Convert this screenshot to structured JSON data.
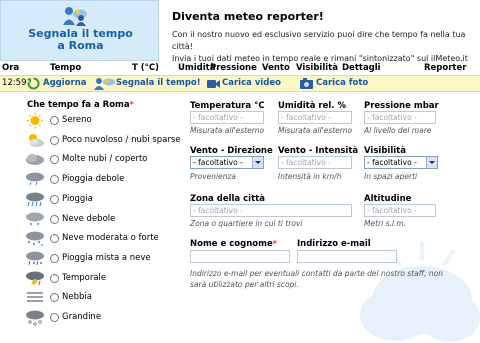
{
  "banner": {
    "icon": "reporter-people-icon",
    "line1": "Segnala il tempo",
    "line2": "a Roma"
  },
  "promo": {
    "title": "Diventa meteo reporter!",
    "line1": "Con il nostro nuovo ed esclusivo servizio puoi dire che tempo fa nella tua città!",
    "line2": "Invia i tuoi dati meteo in tempo reale e rimani \"sintonizzato\" sul ilMeteo.it"
  },
  "header": {
    "ora": "Ora",
    "tempo": "Tempo",
    "temp": "T (°C)",
    "umidita": "Umidità",
    "pressione": "Pressione",
    "vento": "Vento",
    "visibilita": "Visibilità",
    "dettagli": "Dettagli",
    "reporter": "Reporter"
  },
  "toolbar": {
    "time": "12:59",
    "refresh": "Aggiorna",
    "report": "Segnala il tempo!",
    "video": "Carica video",
    "photo": "Carica foto"
  },
  "weather": {
    "title": "Che tempo fa a Roma",
    "required_mark": "*",
    "options": [
      {
        "label": "Sereno",
        "icon": "sun-icon"
      },
      {
        "label": "Poco nuvoloso / nubi sparse",
        "icon": "sun-cloud-icon"
      },
      {
        "label": "Molte nubi / coperto",
        "icon": "cloud-icon"
      },
      {
        "label": "Pioggia debole",
        "icon": "light-rain-icon"
      },
      {
        "label": "Pioggia",
        "icon": "rain-icon"
      },
      {
        "label": "Neve debole",
        "icon": "light-snow-icon"
      },
      {
        "label": "Neve moderata o forte",
        "icon": "snow-icon"
      },
      {
        "label": "Pioggia mista a neve",
        "icon": "sleet-icon"
      },
      {
        "label": "Temporale",
        "icon": "thunderstorm-icon"
      },
      {
        "label": "Nebbia",
        "icon": "fog-icon"
      },
      {
        "label": "Grandine",
        "icon": "hail-icon"
      }
    ]
  },
  "form": {
    "placeholder": "- facoltativo -",
    "temperature": {
      "label": "Temperatura °C",
      "note": "Misurata all'esterno"
    },
    "humidity": {
      "label": "Umidità rel. %",
      "note": "Misurata all'esterno"
    },
    "pressure": {
      "label": "Pressione mbar",
      "note": "Al livello del mare"
    },
    "wind_dir": {
      "label": "Vento - Direzione",
      "value": "- facoltativo -",
      "note": "Provenienza"
    },
    "wind_int": {
      "label": "Vento - Intensità",
      "note": "Intensità in km/h"
    },
    "visibility": {
      "label": "Visibilità",
      "value": "- facoltativo -",
      "note": "In spazi aperti"
    },
    "zone": {
      "label": "Zona della città",
      "note": "Zona o quartiere in cui ti trovi"
    },
    "altitude": {
      "label": "Altitudine",
      "note": "Metri s.l.m."
    },
    "name": {
      "label": "Nome e cognome"
    },
    "email": {
      "label": "Indirizzo e-mail"
    },
    "privacy_line1": "Indirizzo e-mail per eventuali contatti da parte del nostro staff, non",
    "privacy_line2": "sarà utilizzato per altri scopi."
  },
  "colors": {
    "accent": "#1a55a5",
    "toolbar_bg": "#fbf8c6",
    "banner_bg": "#d6ebfa",
    "required": "#e03c2a"
  }
}
